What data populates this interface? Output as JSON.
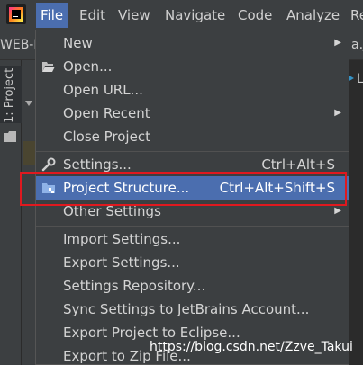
{
  "menubar": {
    "items": [
      {
        "label": "File",
        "active": true
      },
      {
        "label": "Edit"
      },
      {
        "label": "View"
      },
      {
        "label": "Navigate"
      },
      {
        "label": "Code"
      },
      {
        "label": "Analyze"
      },
      {
        "label": "Re"
      }
    ]
  },
  "background": {
    "project_name": "WEB-I",
    "file_tab_fragment": "a.ja",
    "right_fragment": "L",
    "tool_window_tab": "1: Project"
  },
  "file_menu": {
    "items": [
      {
        "label": "New",
        "submenu": true
      },
      {
        "label": "Open...",
        "icon": "folder-open-icon"
      },
      {
        "label": "Open URL..."
      },
      {
        "label": "Open Recent",
        "submenu": true
      },
      {
        "label": "Close Project"
      },
      {
        "label": "Settings...",
        "shortcut": "Ctrl+Alt+S",
        "icon": "wrench-icon"
      },
      {
        "label": "Project Structure...",
        "shortcut": "Ctrl+Alt+Shift+S",
        "icon": "project-structure-icon",
        "selected": true
      },
      {
        "label": "Other Settings",
        "submenu": true
      },
      {
        "label": "Import Settings..."
      },
      {
        "label": "Export Settings..."
      },
      {
        "label": "Settings Repository..."
      },
      {
        "label": "Sync Settings to JetBrains Account..."
      },
      {
        "label": "Export Project to Eclipse..."
      },
      {
        "label": "Export to Zip File..."
      }
    ]
  },
  "watermark": "https://blog.csdn.net/Zzve_Takui",
  "colors": {
    "selection": "#4b6eaf",
    "highlight_box": "#e0191f",
    "menu_background": "#3c3f41"
  }
}
